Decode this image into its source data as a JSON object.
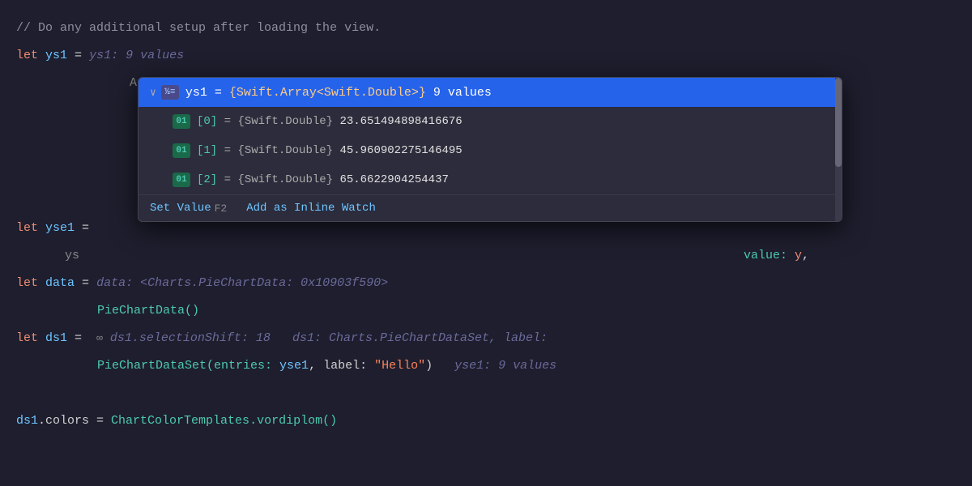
{
  "code": {
    "line1": "// Do any additional setup after loading the view.",
    "line2_kw": "let",
    "line2_var": "ys1",
    "line2_eq": " = ",
    "line2_inline": "ys1: 9 values",
    "line3_indent": "    Ar",
    "line4_kw": "let",
    "line4_var": "yse1",
    "line4_eq": " =",
    "line5_indent": "    ys",
    "line5_rest": "                                                           value: y,",
    "line6_kw": "let",
    "line6_var": "data",
    "line6_eq": " = ",
    "line6_inline": "data: <Charts.PieChartData: 0x10903f590>",
    "line7_indent": "        ",
    "line7_call": "PieChartData()",
    "line8_kw": "let",
    "line8_var": "ds1",
    "line8_eq": " =  ",
    "line8_inline1": "ds1.selectionShift: 18",
    "line8_inline2": "ds1: Charts.PieChartDataSet, label:",
    "line9_indent": "        ",
    "line9_call": "PieChartDataSet(entries: ",
    "line9_param1": "yse1",
    "line9_comma": ", label: ",
    "line9_str": "\"Hello\"",
    "line9_close": ")",
    "line9_inline": "yse1: 9 values",
    "line10_empty": "",
    "line11_var": "ds1",
    "line11_dot": ".colors = ",
    "line11_method": "ChartColorTemplates",
    "line11_call": ".vordiplom()"
  },
  "dropdown": {
    "selected_item": {
      "chevron": "∨",
      "badge_symbol": "½≡",
      "text": "ys1 = {Swift.Array<Swift.Double>} 9 values"
    },
    "items": [
      {
        "badge": "01",
        "index": "[0]",
        "type": "{Swift.Double}",
        "value": "23.651494898416676"
      },
      {
        "badge": "01",
        "index": "[1]",
        "type": "{Swift.Double}",
        "value": "45.960902275146495"
      },
      {
        "badge": "01",
        "index": "[2]",
        "type": "{Swift.Double}",
        "value": "65.6622904254437"
      }
    ],
    "footer": {
      "set_value_label": "Set Value",
      "set_value_key": "F2",
      "inline_watch_label": "Add as Inline Watch"
    }
  }
}
